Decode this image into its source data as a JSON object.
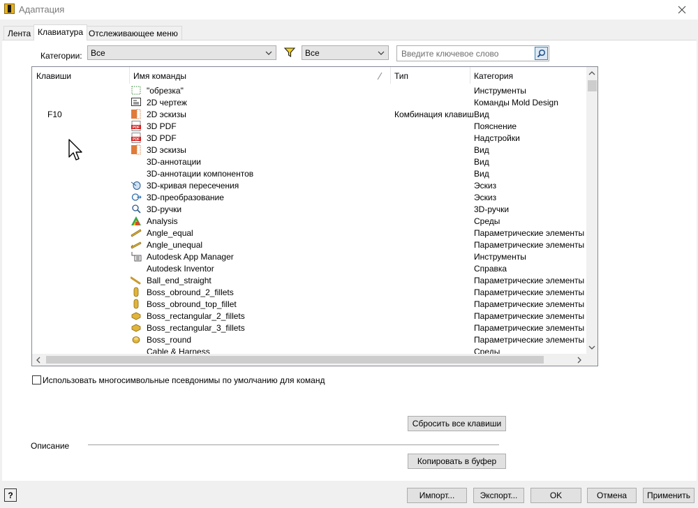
{
  "window": {
    "title": "Адаптация"
  },
  "tabs": [
    {
      "label": "Лента"
    },
    {
      "label": "Клавиатура",
      "active": true
    },
    {
      "label": "Отслеживающее меню"
    }
  ],
  "filters": {
    "categories_label": "Категории:",
    "category_value": "Все",
    "type_value": "Все",
    "search_placeholder": "Введите ключевое слово"
  },
  "table": {
    "columns": [
      "Клавиши",
      "Имя команды",
      "Тип",
      "Категория"
    ],
    "rows": [
      {
        "keys": "",
        "icon": "trim-icon",
        "name": "\"обрезка\"",
        "type": "",
        "category": "Инструменты"
      },
      {
        "keys": "",
        "icon": "drawing-icon",
        "name": "2D чертеж",
        "type": "",
        "category": "Команды Mold Design"
      },
      {
        "keys": "F10",
        "icon": "sketch-icon",
        "name": "2D эскизы",
        "type": "Комбинация клавиш",
        "category": "Вид"
      },
      {
        "keys": "",
        "icon": "pdf-icon",
        "name": "3D PDF",
        "type": "",
        "category": "Пояснение"
      },
      {
        "keys": "",
        "icon": "pdf-icon",
        "name": "3D PDF",
        "type": "",
        "category": "Надстройки"
      },
      {
        "keys": "",
        "icon": "sketch-icon",
        "name": "3D эскизы",
        "type": "",
        "category": "Вид"
      },
      {
        "keys": "",
        "icon": "",
        "name": "3D-аннотации",
        "type": "",
        "category": "Вид"
      },
      {
        "keys": "",
        "icon": "",
        "name": "3D-аннотации компонентов",
        "type": "",
        "category": "Вид"
      },
      {
        "keys": "",
        "icon": "intersection-curve-icon",
        "name": "3D-кривая пересечения",
        "type": "",
        "category": "Эскиз"
      },
      {
        "keys": "",
        "icon": "transform-icon",
        "name": "3D-преобразование",
        "type": "",
        "category": "Эскиз"
      },
      {
        "keys": "",
        "icon": "grips-icon",
        "name": "3D-ручки",
        "type": "",
        "category": "3D-ручки"
      },
      {
        "keys": "",
        "icon": "analysis-icon",
        "name": "Analysis",
        "type": "",
        "category": "Среды"
      },
      {
        "keys": "",
        "icon": "angle-equal-icon",
        "name": "Angle_equal",
        "type": "",
        "category": "Параметрические элементы"
      },
      {
        "keys": "",
        "icon": "angle-unequal-icon",
        "name": "Angle_unequal",
        "type": "",
        "category": "Параметрические элементы"
      },
      {
        "keys": "",
        "icon": "app-manager-icon",
        "name": "Autodesk App Manager",
        "type": "",
        "category": "Инструменты"
      },
      {
        "keys": "",
        "icon": "",
        "name": "Autodesk Inventor",
        "type": "",
        "category": "Справка"
      },
      {
        "keys": "",
        "icon": "ball-end-icon",
        "name": "Ball_end_straight",
        "type": "",
        "category": "Параметрические элементы"
      },
      {
        "keys": "",
        "icon": "boss-obround-icon",
        "name": "Boss_obround_2_fillets",
        "type": "",
        "category": "Параметрические элементы"
      },
      {
        "keys": "",
        "icon": "boss-obround-icon",
        "name": "Boss_obround_top_fillet",
        "type": "",
        "category": "Параметрические элементы"
      },
      {
        "keys": "",
        "icon": "boss-rect-icon",
        "name": "Boss_rectangular_2_fillets",
        "type": "",
        "category": "Параметрические элементы"
      },
      {
        "keys": "",
        "icon": "boss-rect-icon",
        "name": "Boss_rectangular_3_fillets",
        "type": "",
        "category": "Параметрические элементы"
      },
      {
        "keys": "",
        "icon": "boss-round-icon",
        "name": "Boss_round",
        "type": "",
        "category": "Параметрические элементы"
      },
      {
        "keys": "",
        "icon": "",
        "name": "Cable & Harness",
        "type": "",
        "category": "Среды"
      }
    ]
  },
  "options": {
    "multichar_alias_label": "Использовать многосимвольные псевдонимы по умолчанию для команд",
    "multichar_alias_checked": false
  },
  "buttons": {
    "reset_all": "Сбросить все клавиши",
    "copy_clipboard": "Копировать в буфер",
    "import": "Импорт...",
    "export": "Экспорт...",
    "ok": "OK",
    "cancel": "Отмена",
    "apply": "Применить"
  },
  "description": {
    "label": "Описание"
  },
  "help": {
    "label": "?"
  }
}
